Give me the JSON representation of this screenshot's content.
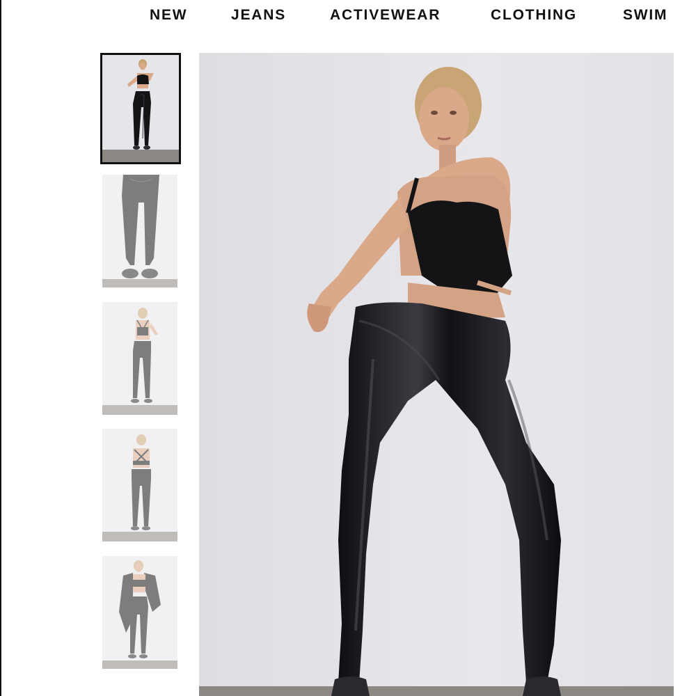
{
  "nav": {
    "items": [
      {
        "label": "NEW"
      },
      {
        "label": "JEANS"
      },
      {
        "label": "ACTIVEWEAR"
      },
      {
        "label": "CLOTHING"
      },
      {
        "label": "SWIM"
      }
    ]
  },
  "gallery": {
    "selected_index": 0,
    "thumbnail_count": 5,
    "thumbnails": [
      {
        "view": "front-full"
      },
      {
        "view": "legs-closeup"
      },
      {
        "view": "back-full"
      },
      {
        "view": "back-full-alt"
      },
      {
        "view": "front-with-jacket"
      }
    ],
    "main_view": "front-full"
  },
  "colors": {
    "background": "#ffffff",
    "photo_backdrop": "#e5e4e8",
    "photo_floor": "#8c8783",
    "garment": "#141416",
    "skin": "#d9a98a",
    "hair": "#c9a576",
    "text": "#111111"
  }
}
